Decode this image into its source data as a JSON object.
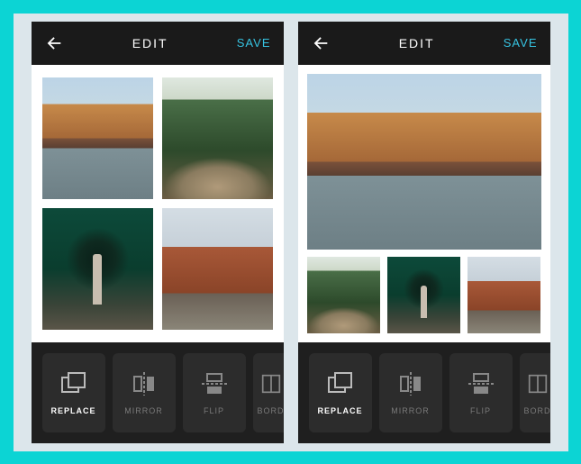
{
  "screens": {
    "left": {
      "header": {
        "title": "EDIT",
        "save": "SAVE"
      },
      "toolbar": {
        "items": [
          {
            "label": "REPLACE",
            "active": true
          },
          {
            "label": "MIRROR",
            "active": false
          },
          {
            "label": "FLIP",
            "active": false
          },
          {
            "label": "BORDER",
            "active": false
          }
        ]
      }
    },
    "right": {
      "header": {
        "title": "EDIT",
        "save": "SAVE"
      },
      "toolbar": {
        "items": [
          {
            "label": "REPLACE",
            "active": true
          },
          {
            "label": "MIRROR",
            "active": false
          },
          {
            "label": "FLIP",
            "active": false
          },
          {
            "label": "BORDER",
            "active": false
          }
        ]
      }
    }
  },
  "colors": {
    "accent": "#36c2e0",
    "barBg": "#1a1a1a",
    "toolBg": "#2c2c2c"
  }
}
